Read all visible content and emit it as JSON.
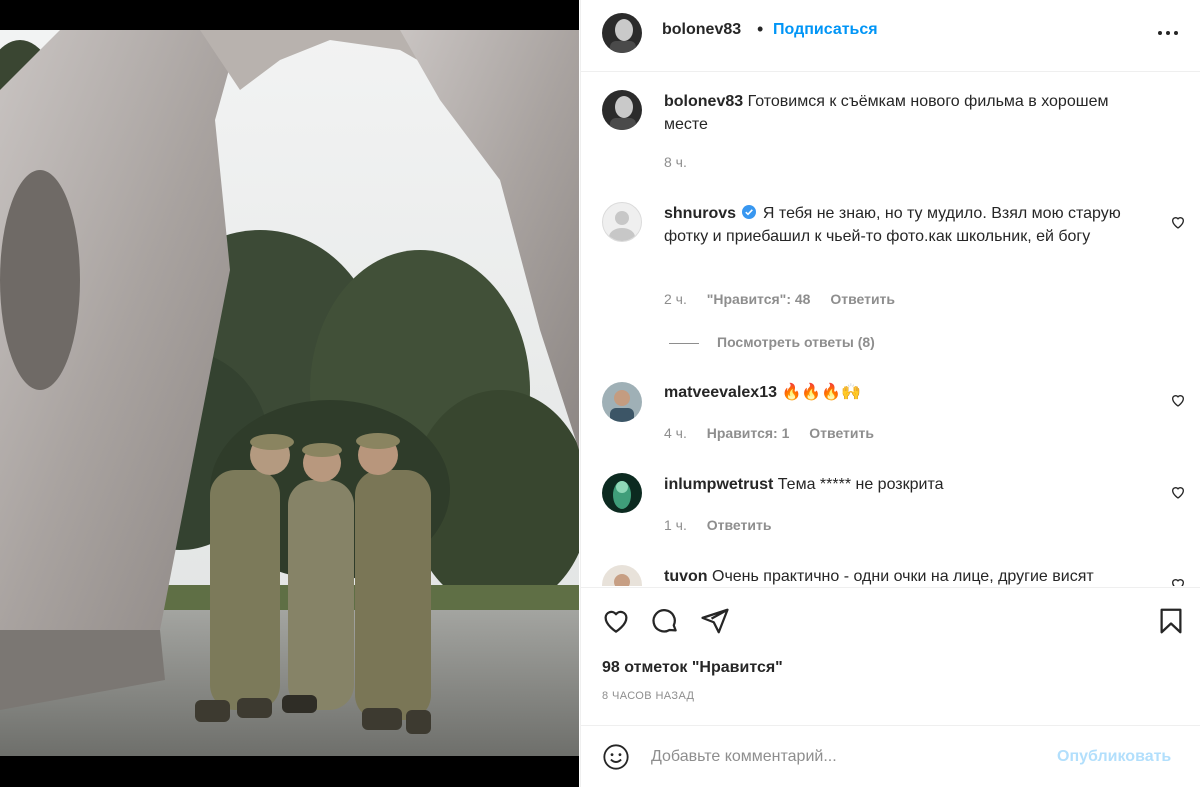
{
  "post": {
    "username": "bolonev83",
    "follow_label": "Подписаться",
    "caption": "Готовимся к съёмкам нового фильма в хорошем месте",
    "caption_time": "8 ч.",
    "likes": "98 отметок \"Нравится\"",
    "posted_ago": "8 часов назад"
  },
  "comments": [
    {
      "username": "shnurovs",
      "verified": true,
      "text": "Я тебя не знаю, но ту мудило. Взял мою старую фотку и приебашил к чьей-то фото.как школьник, ей богу",
      "time": "2 ч.",
      "likes": "\"Нравится\": 48",
      "reply": "Ответить",
      "view_replies": "Посмотреть ответы (8)"
    },
    {
      "username": "matveevalex13",
      "text": "🔥🔥🔥🙌",
      "time": "4 ч.",
      "likes": "Нравится: 1",
      "reply": "Ответить"
    },
    {
      "username": "inlumpwetrust",
      "text": "Тема ***** не розкрита",
      "time": "1 ч.",
      "reply": "Ответить"
    },
    {
      "username": "tuvon",
      "text": "Очень практично - одни очки на лице, другие висят"
    }
  ],
  "composer": {
    "placeholder": "Добавьте комментарий...",
    "publish_label": "Опубликовать"
  },
  "colors": {
    "accent": "#0095f6",
    "accent_disabled": "#b2dffc",
    "secondary_text": "#8e8e8e",
    "primary_text": "#262626",
    "border": "#efefef"
  },
  "icons": [
    "more-icon",
    "heart-icon",
    "comment-icon",
    "share-icon",
    "bookmark-icon",
    "emoji-icon",
    "verified-icon"
  ]
}
